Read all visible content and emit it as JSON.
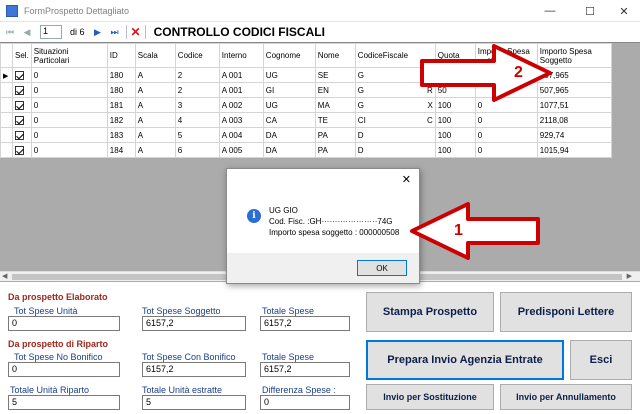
{
  "window": {
    "title": "FormProspetto Dettagliato"
  },
  "toolbar": {
    "page_value": "1",
    "of_label": "di 6",
    "screen_title": "CONTROLLO CODICI FISCALI"
  },
  "grid": {
    "headers": [
      "Sel.",
      "Situazioni Particolari",
      "ID",
      "Scala",
      "Codice",
      "Interno",
      "Cognome",
      "Nome",
      "CodiceFiscale",
      "Quota",
      "Importo Spesa ... ata",
      "Importo Spesa Soggetto"
    ],
    "rows": [
      {
        "sit": "0",
        "id": "180",
        "scala": "A",
        "codice": "2",
        "interno": "A 001",
        "cognome": "UG",
        "nome": "SE",
        "cf": "G",
        "cf_tail": "G",
        "quota": "5",
        "imp1": "",
        "imp2": "507,965"
      },
      {
        "sit": "0",
        "id": "180",
        "scala": "A",
        "codice": "2",
        "interno": "A 001",
        "cognome": "GI",
        "nome": "EN",
        "cf": "G",
        "cf_tail": "R",
        "quota": "50",
        "imp1": "",
        "imp2": "507,965"
      },
      {
        "sit": "0",
        "id": "181",
        "scala": "A",
        "codice": "3",
        "interno": "A 002",
        "cognome": "UG",
        "nome": "MA",
        "cf": "G",
        "cf_tail": "X",
        "quota": "100",
        "imp1": "0",
        "imp2": "1077,51"
      },
      {
        "sit": "0",
        "id": "182",
        "scala": "A",
        "codice": "4",
        "interno": "A 003",
        "cognome": "CA",
        "nome": "TE",
        "cf": "CI",
        "cf_tail": "C",
        "quota": "100",
        "imp1": "0",
        "imp2": "2118,08"
      },
      {
        "sit": "0",
        "id": "183",
        "scala": "A",
        "codice": "5",
        "interno": "A 004",
        "cognome": "DA",
        "nome": "PA",
        "cf": "D",
        "cf_tail": "",
        "quota": "100",
        "imp1": "0",
        "imp2": "929,74"
      },
      {
        "sit": "0",
        "id": "184",
        "scala": "A",
        "codice": "6",
        "interno": "A 005",
        "cognome": "DA",
        "nome": "PA",
        "cf": "D",
        "cf_tail": "",
        "quota": "100",
        "imp1": "0",
        "imp2": "1015,94"
      }
    ]
  },
  "dialog": {
    "line1": "UG                GIO",
    "line2": "Cod. Fisc. :GH·····················74G",
    "line3": "Importo spesa soggetto : 000000508",
    "ok_label": "OK"
  },
  "annotations": {
    "arrow1_label": "1",
    "arrow2_label": "2",
    "arrow_color": "#cc0000"
  },
  "elaborato": {
    "section_title": "Da prospetto Elaborato",
    "tot_spese_unita_label": "Tot Spese Unità",
    "tot_spese_unita": "0",
    "tot_spese_soggetto_label": "Tot Spese Soggetto",
    "tot_spese_soggetto": "6157,2",
    "totale_spese_label": "Totale Spese",
    "totale_spese": "6157,2"
  },
  "riparto": {
    "section_title": "Da prospetto di Riparto",
    "no_bonifico_label": "Tot Spese No Bonifico",
    "no_bonifico": "0",
    "con_bonifico_label": "Tot Spese Con Bonifico",
    "con_bonifico": "6157,2",
    "totale_spese_label": "Totale Spese",
    "totale_spese": "6157,2",
    "unita_riparto_label": "Totale Unità Riparto",
    "unita_riparto": "5",
    "unita_estratte_label": "Totale Unità estratte",
    "unita_estratte": "5",
    "differenza_label": "Differenza Spese :",
    "differenza": "0"
  },
  "buttons": {
    "stampa": "Stampa Prospetto",
    "lettere": "Predisponi Lettere",
    "agenzia": "Prepara Invio Agenzia Entrate",
    "esci": "Esci",
    "sostituzione": "Invio per Sostituzione",
    "annullamento": "Invio per Annullamento"
  }
}
